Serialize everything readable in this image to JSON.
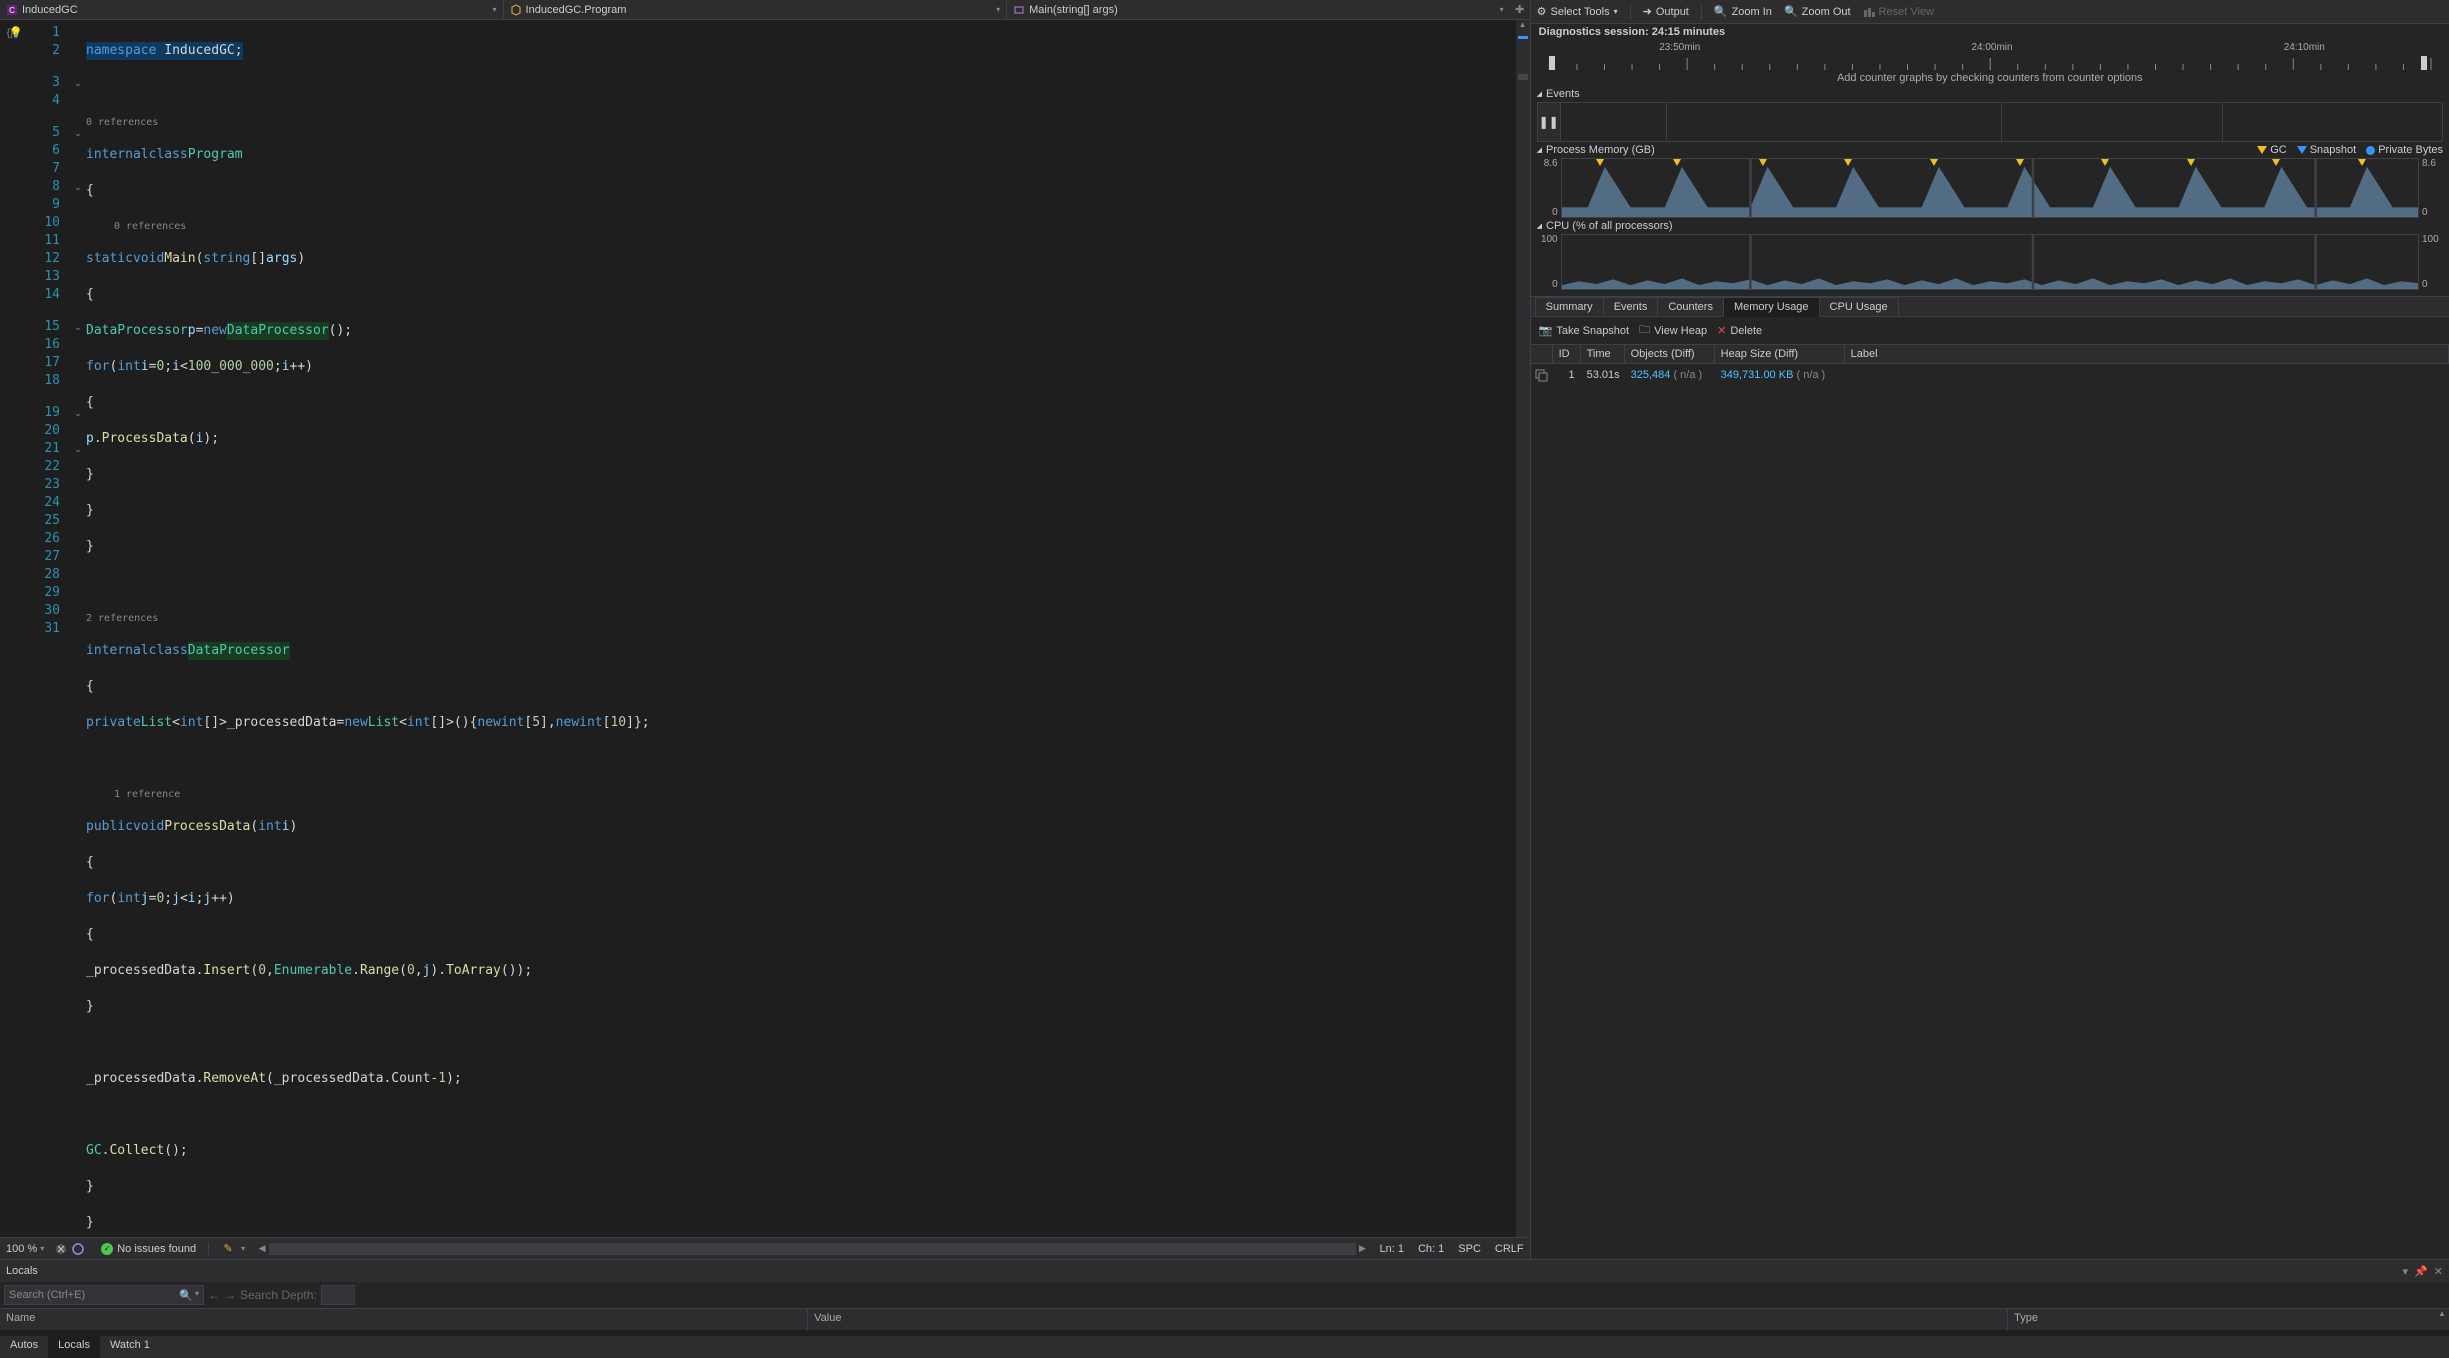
{
  "breadcrumb": {
    "project": "InducedGC",
    "class": "InducedGC.Program",
    "method": "Main(string[] args)"
  },
  "code": {
    "namespace_line": "namespace InducedGC;",
    "refs0": "0 references",
    "class1_kw": "internal class",
    "class1_name": "Program",
    "refs1": "0 references",
    "main_sig_static": "static",
    "main_sig_void": "void",
    "main_sig_name": "Main",
    "main_sig_string": "string",
    "main_sig_args": "args",
    "dp_type": "DataProcessor",
    "p_var": "p",
    "new_kw": "new",
    "for_kw": "for",
    "int_kw": "int",
    "i_var": "i",
    "limit": "100_000_000",
    "process_call": "ProcessData",
    "refs2": "2 references",
    "class2_kw": "internal class",
    "class2_name": "DataProcessor",
    "private_kw": "private",
    "list_type": "List",
    "field_name": "_processedData",
    "arr5": "5",
    "arr10": "10",
    "refs3": "1 reference",
    "public_kw": "public",
    "void_kw": "void",
    "pd_name": "ProcessData",
    "j_var": "j",
    "insert": "Insert",
    "enumerable": "Enumerable",
    "range": "Range",
    "toarray": "ToArray",
    "removeat": "RemoveAt",
    "count": "Count",
    "gc": "GC",
    "collect": "Collect",
    "zero": "0",
    "one": "1"
  },
  "status": {
    "zoom": "100 %",
    "issues": "No issues found",
    "ln": "Ln: 1",
    "ch": "Ch: 1",
    "spc": "SPC",
    "crlf": "CRLF"
  },
  "diag": {
    "toolbar": {
      "select_tools": "Select Tools",
      "output": "Output",
      "zoom_in": "Zoom In",
      "zoom_out": "Zoom Out",
      "reset_view": "Reset View"
    },
    "session": "Diagnostics session: 24:15 minutes",
    "ruler": {
      "t1": "23:50min",
      "t2": "24:00min",
      "t3": "24:10min"
    },
    "hint": "Add counter graphs by checking counters from counter options",
    "events_hdr": "Events",
    "mem_hdr": "Process Memory (GB)",
    "mem_legend_gc": "GC",
    "mem_legend_snap": "Snapshot",
    "mem_legend_priv": "Private Bytes",
    "mem_y_hi": "8.6",
    "mem_y_lo": "0",
    "cpu_hdr": "CPU (% of all processors)",
    "cpu_y_hi": "100",
    "cpu_y_lo": "0",
    "tabs": {
      "summary": "Summary",
      "events": "Events",
      "counters": "Counters",
      "mem": "Memory Usage",
      "cpu": "CPU Usage"
    },
    "snap_toolbar": {
      "take": "Take Snapshot",
      "view": "View Heap",
      "delete": "Delete"
    },
    "snap_headers": {
      "id": "ID",
      "time": "Time",
      "objects": "Objects (Diff)",
      "heap": "Heap Size (Diff)",
      "label": "Label"
    },
    "snap_row": {
      "id": "1",
      "time": "53.01s",
      "objects": "325,484",
      "objects_diff": "( n/a )",
      "heap": "349,731.00 KB",
      "heap_diff": "( n/a )"
    }
  },
  "locals": {
    "title": "Locals",
    "search_placeholder": "Search (Ctrl+E)",
    "depth_label": "Search Depth:",
    "headers": {
      "name": "Name",
      "value": "Value",
      "type": "Type"
    },
    "tabs": {
      "autos": "Autos",
      "locals": "Locals",
      "watch": "Watch 1"
    }
  }
}
